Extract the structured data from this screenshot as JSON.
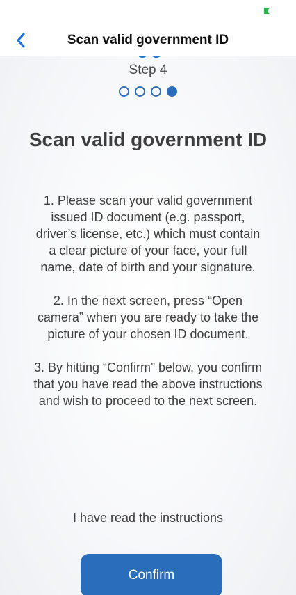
{
  "status_bar": {
    "battery_icon": "battery-charging-icon",
    "accent": "#2bb24c"
  },
  "nav": {
    "back_icon": "chevron-left-icon",
    "title": "Scan valid government ID"
  },
  "step": {
    "label": "Step 4",
    "total": 4,
    "current": 4
  },
  "heading": "Scan valid government ID",
  "instructions": [
    "1. Please scan your valid government issued ID document (e.g. passport, driver’s license, etc.) which must contain a clear picture of your face, your full name, date of birth and your signature.",
    "2. In the next screen, press “Open camera” when you are ready to take the picture of your chosen ID document.",
    "3. By hitting “Confirm” below, you confirm that you have read the above instructions and wish to proceed to the next screen."
  ],
  "acknowledgement": "I have read the instructions",
  "confirm_label": "Confirm",
  "colors": {
    "primary": "#2a6ebb",
    "text": "#3d3d3d",
    "nav_chevron": "#1a73e8"
  }
}
